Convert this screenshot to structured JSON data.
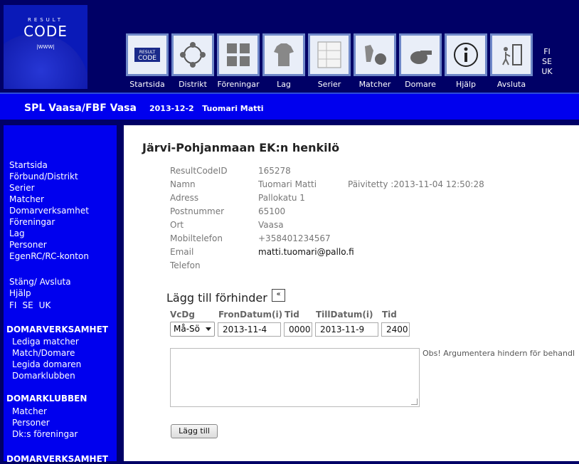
{
  "logo": {
    "line1": "RESULT",
    "line2": "CODE",
    "line3": "|WWW|"
  },
  "nav": [
    {
      "label": "Startsida",
      "icon": "resultcode-logo-icon"
    },
    {
      "label": "Distrikt",
      "icon": "district-people-icon"
    },
    {
      "label": "Föreningar",
      "icon": "clubs-jerseys-icon"
    },
    {
      "label": "Lag",
      "icon": "team-jersey-icon"
    },
    {
      "label": "Serier",
      "icon": "series-table-icon"
    },
    {
      "label": "Matcher",
      "icon": "match-players-icon"
    },
    {
      "label": "Domare",
      "icon": "whistle-icon"
    },
    {
      "label": "Hjälp",
      "icon": "info-icon"
    },
    {
      "label": "Avsluta",
      "icon": "exit-door-icon"
    }
  ],
  "languages": [
    "FI",
    "SE",
    "UK"
  ],
  "band": {
    "app_title": "SPL Vaasa/FBF Vasa",
    "date": "2013-12-2",
    "user": "Tuomari Matti"
  },
  "sidebar": {
    "main_links": [
      "Startsida",
      "Förbund/Distrikt",
      "Serier",
      "Matcher",
      "Domarverksamhet",
      "Föreningar",
      "Lag",
      "Personer",
      "EgenRC/RC-konton"
    ],
    "secondary_links": [
      "Stäng/ Avsluta",
      "Hjälp"
    ],
    "section1": {
      "title": "DOMARVERKSAMHET",
      "items": [
        "Lediga matcher",
        "Match/Domare",
        "Legida domaren",
        "Domarklubben"
      ]
    },
    "section2": {
      "title": "DOMARKLUBBEN",
      "items": [
        "Matcher",
        "Personer",
        "Dk:s föreningar"
      ]
    },
    "section3": {
      "title": "DOMARVERKSAMHET"
    }
  },
  "page": {
    "title": "Järvi-Pohjanmaan EK:n henkilö",
    "updated": "Päivitetty :2013-11-04 12:50:28",
    "fields": [
      {
        "label": "ResultCodeID",
        "value": "165278"
      },
      {
        "label": "Namn",
        "value": "Tuomari Matti"
      },
      {
        "label": "Adress",
        "value": "Pallokatu 1"
      },
      {
        "label": "Postnummer",
        "value": "65100"
      },
      {
        "label": "Ort",
        "value": "Vaasa"
      },
      {
        "label": "Mobiltelefon",
        "value": "+358401234567"
      },
      {
        "label": "Email",
        "value": "matti.tuomari@pallo.fi"
      },
      {
        "label": "Telefon",
        "value": ""
      }
    ]
  },
  "hinder": {
    "title": "Lägg till förhinder",
    "toggle": "«",
    "headers": {
      "vcdg": "VcDg",
      "from": "FronDatum(i)",
      "tid1": "Tid",
      "till": "TillDatum(i)",
      "tid2": "Tid"
    },
    "vcdg_value": "Må-Sö",
    "from_date": "2013-11-4",
    "from_time": "0000",
    "till_date": "2013-11-9",
    "till_time": "2400",
    "note": "Obs! Argumentera hindern för behandl",
    "add_button": "Lägg till"
  }
}
